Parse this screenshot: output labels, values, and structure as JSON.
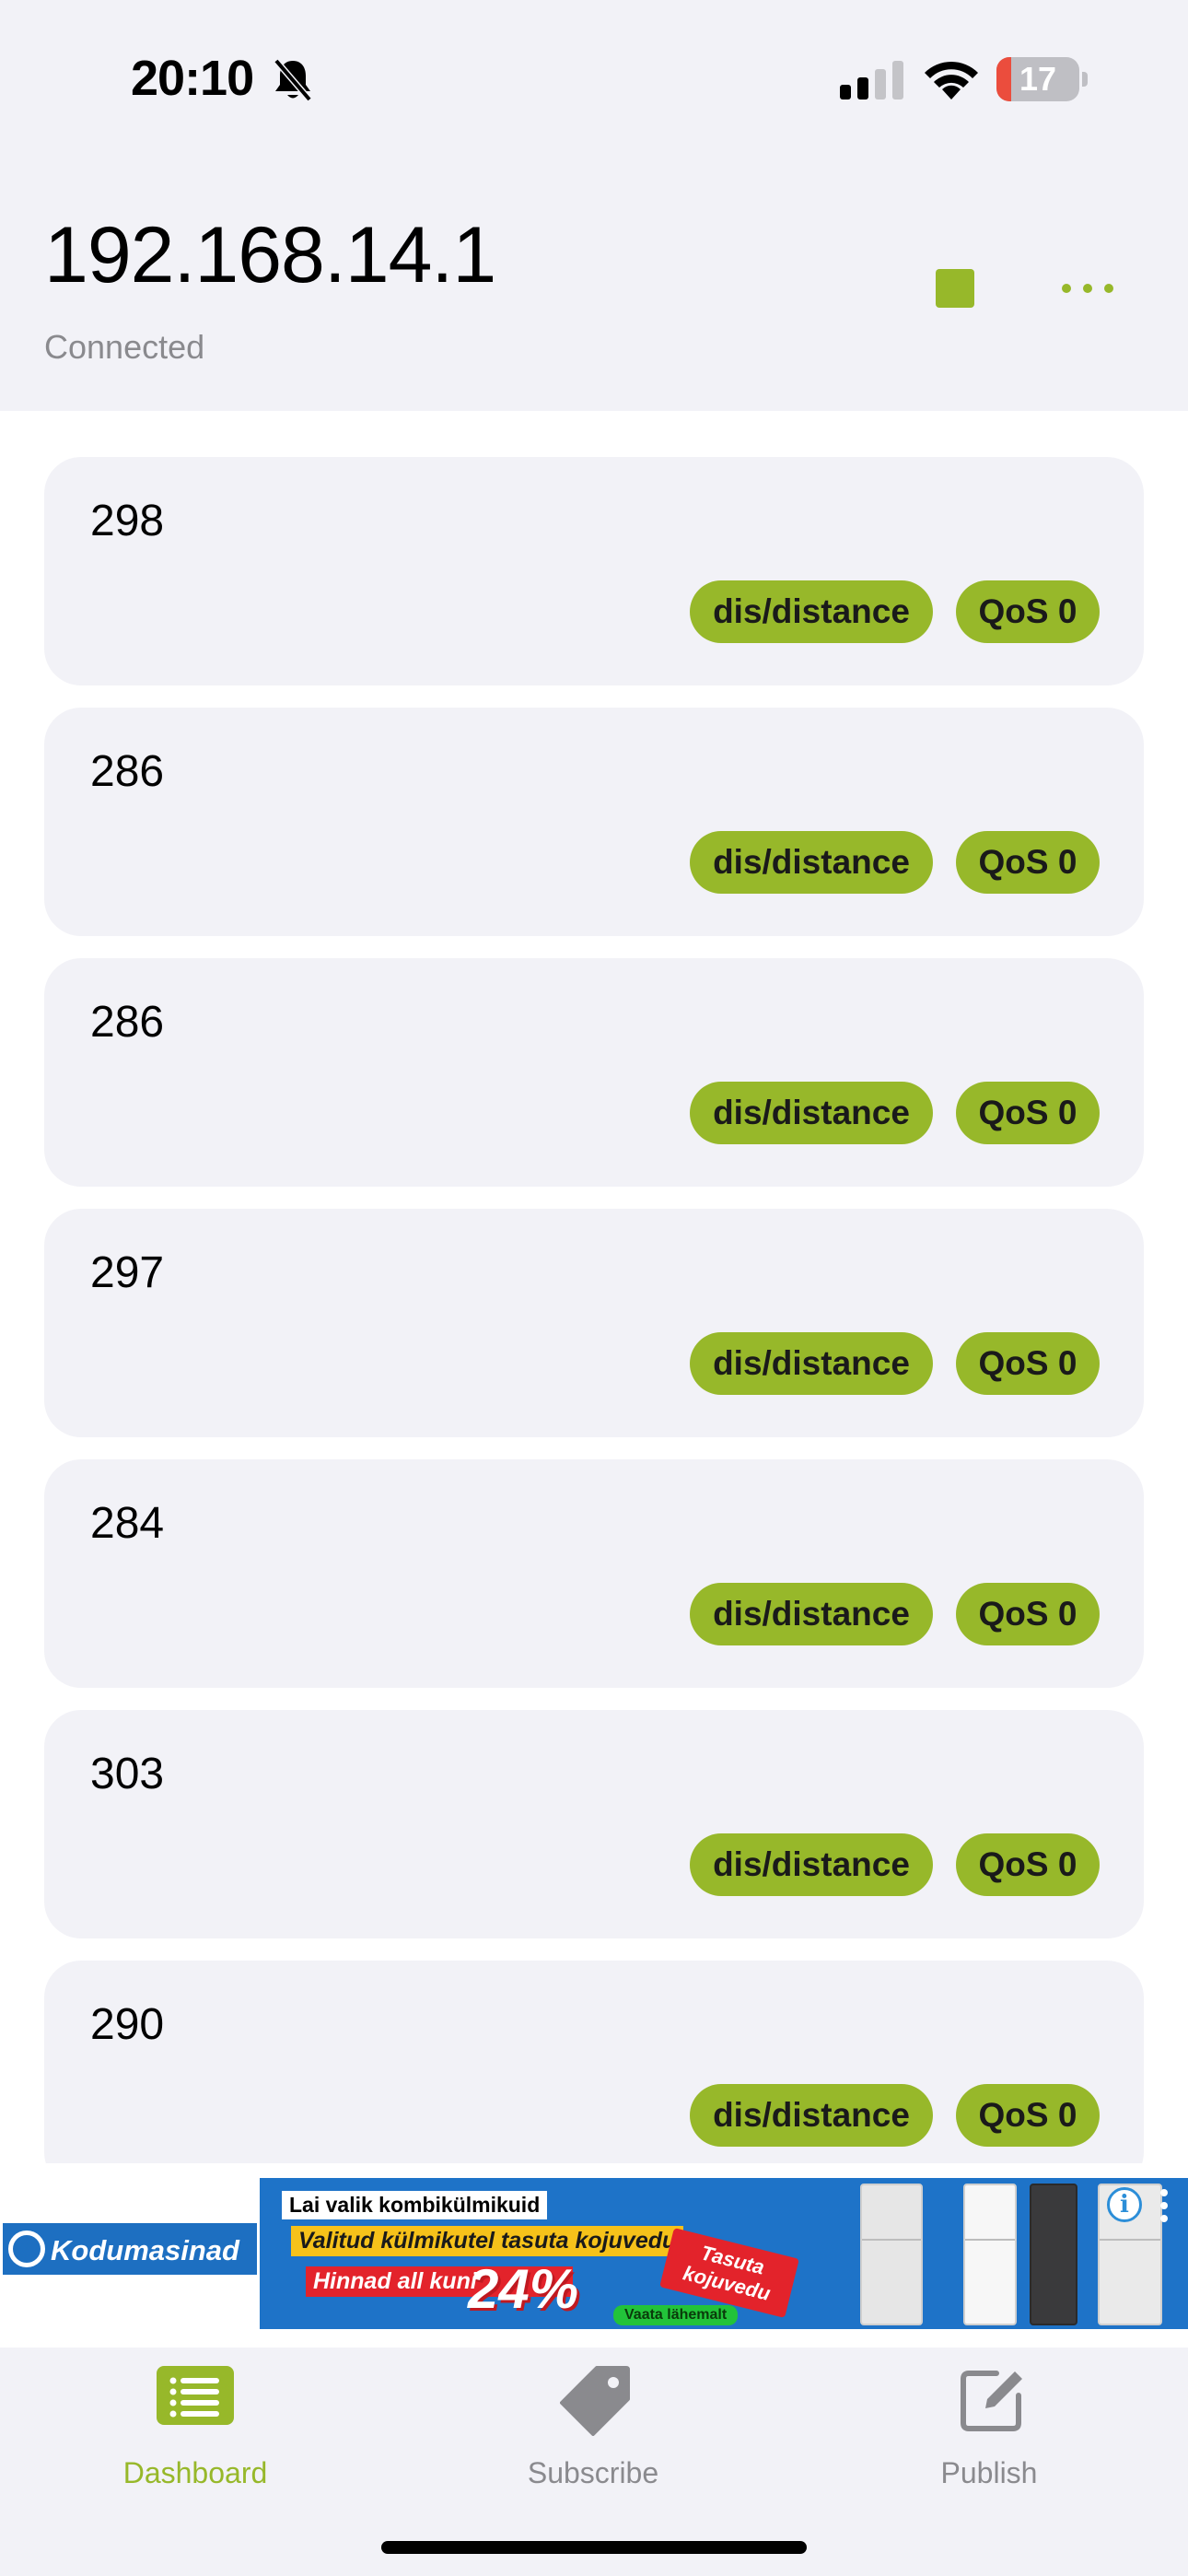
{
  "status_bar": {
    "time": "20:10",
    "battery_level": "17",
    "icons": [
      "bell-slash-icon",
      "cellular-signal-icon",
      "wifi-icon",
      "battery-icon"
    ]
  },
  "header": {
    "host": "192.168.14.1",
    "status": "Connected",
    "actions": [
      "stop-icon",
      "more-icon"
    ]
  },
  "messages": [
    {
      "value": "298",
      "topic": "dis/distance",
      "qos": "QoS 0"
    },
    {
      "value": "286",
      "topic": "dis/distance",
      "qos": "QoS 0"
    },
    {
      "value": "286",
      "topic": "dis/distance",
      "qos": "QoS 0"
    },
    {
      "value": "297",
      "topic": "dis/distance",
      "qos": "QoS 0"
    },
    {
      "value": "284",
      "topic": "dis/distance",
      "qos": "QoS 0"
    },
    {
      "value": "303",
      "topic": "dis/distance",
      "qos": "QoS 0"
    },
    {
      "value": "290",
      "topic": "dis/distance",
      "qos": "QoS 0"
    }
  ],
  "ad": {
    "brand": "Kodumasinad",
    "line1": "Lai valik kombikülmikuid",
    "line2": "Valitud külmikutel tasuta kojuvedu",
    "line3": "Hinnad all kuni",
    "percent": "24%",
    "tag": "Tasuta kojuvedu",
    "cta": "Vaata lähemalt",
    "info": "i"
  },
  "tabs": [
    {
      "label": "Dashboard",
      "icon": "list-icon",
      "active": true
    },
    {
      "label": "Subscribe",
      "icon": "tag-icon",
      "active": false
    },
    {
      "label": "Publish",
      "icon": "compose-icon",
      "active": false
    }
  ],
  "colors": {
    "accent": "#97b82a",
    "background": "#f2f2f7",
    "secondary_text": "#8a8a8e",
    "ad_blue": "#1e73c8"
  }
}
